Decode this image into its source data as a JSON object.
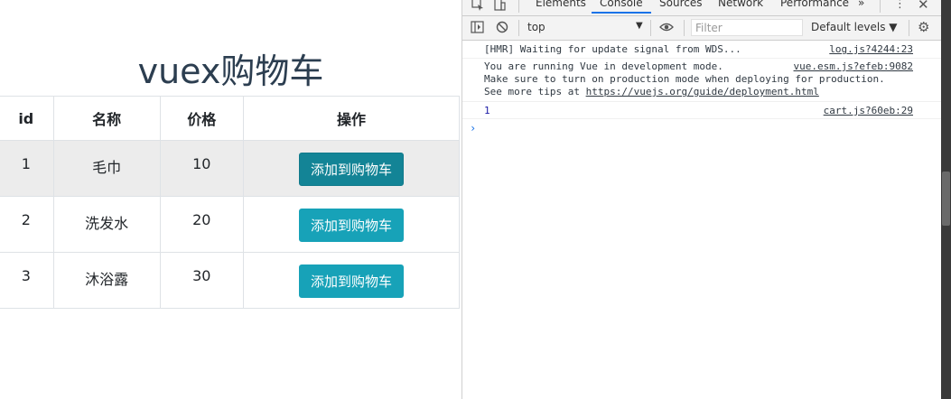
{
  "page": {
    "title": "vuex购物车",
    "table": {
      "headers": [
        "id",
        "名称",
        "价格",
        "操作"
      ],
      "rows": [
        {
          "id": "1",
          "name": "毛巾",
          "price": "10",
          "action": "添加到购物车"
        },
        {
          "id": "2",
          "name": "洗发水",
          "price": "20",
          "action": "添加到购物车"
        },
        {
          "id": "3",
          "name": "沐浴露",
          "price": "30",
          "action": "添加到购物车"
        }
      ]
    }
  },
  "devtools": {
    "tabs": [
      "Elements",
      "Console",
      "Sources",
      "Network",
      "Performance"
    ],
    "active_tab": "Console",
    "more": "»",
    "toolbar": {
      "context": "top",
      "filter_placeholder": "Filter",
      "levels": "Default levels ▼"
    },
    "messages": [
      {
        "text": "[HMR] Waiting for update signal from WDS...",
        "source": "log.js?4244:23"
      },
      {
        "text": "You are running Vue in development mode.\nMake sure to turn on production mode when deploying for production.\nSee more tips at ",
        "link": "https://vuejs.org/guide/deployment.html",
        "source": "vue.esm.js?efeb:9082"
      },
      {
        "text": "1",
        "source": "cart.js?60eb:29"
      }
    ],
    "prompt": "›"
  },
  "colors": {
    "button": "#17a2b8",
    "button_active": "#138496",
    "title": "#2c3e50",
    "accent": "#1a73e8"
  }
}
